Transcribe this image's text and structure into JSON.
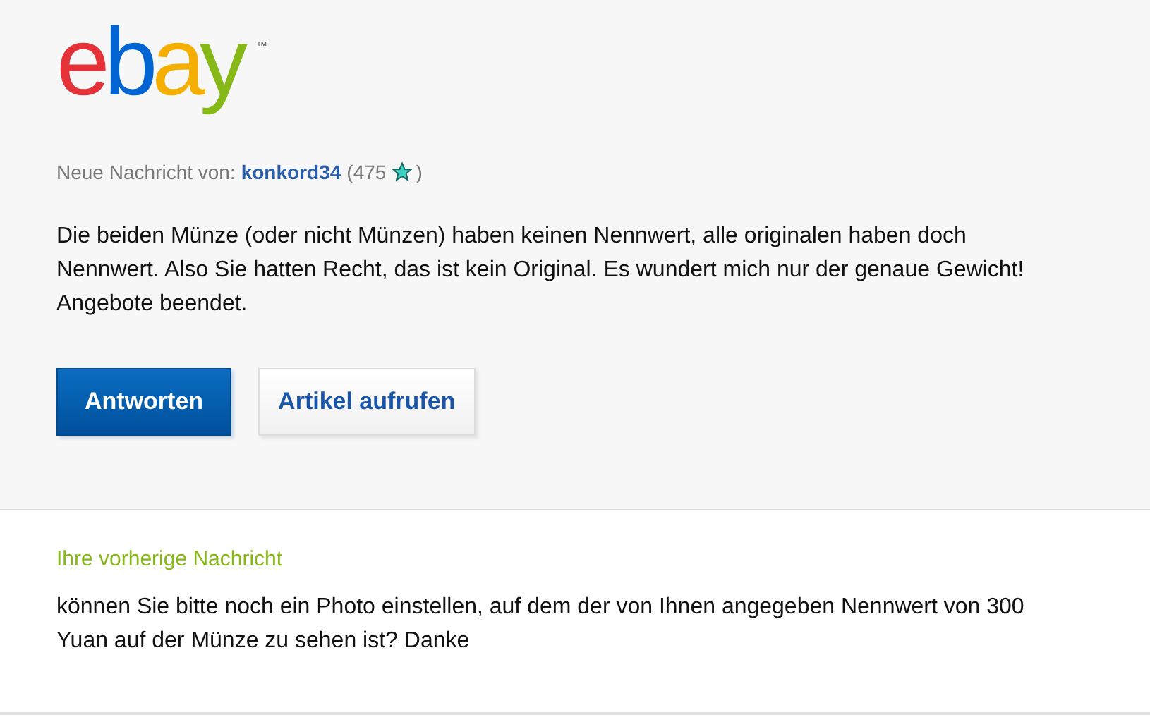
{
  "logo": {
    "letters": [
      {
        "char": "e",
        "color": "#e53238"
      },
      {
        "char": "b",
        "color": "#0064d2"
      },
      {
        "char": "a",
        "color": "#f5af02"
      },
      {
        "char": "y",
        "color": "#86b817"
      }
    ],
    "mark": "™"
  },
  "message": {
    "from_label": "Neue Nachricht von:",
    "sender": "konkord34",
    "rating_open": "(475",
    "rating_close": ")",
    "body": "Die beiden Münze (oder nicht Münzen) haben keinen Nennwert, alle originalen haben doch Nennwert. Also Sie hatten Recht, das ist kein Original. Es wundert mich nur der genaue Gewicht! Angebote beendet."
  },
  "buttons": [
    {
      "label": "Antworten",
      "kind": "primary"
    },
    {
      "label": "Artikel aufrufen",
      "kind": "secondary"
    }
  ],
  "previous": {
    "heading": "Ihre vorherige Nachricht",
    "body": "können Sie bitte noch ein Photo einstellen, auf dem der von Ihnen angegeben Nennwert von 300 Yuan auf der Münze zu sehen ist? Danke"
  }
}
